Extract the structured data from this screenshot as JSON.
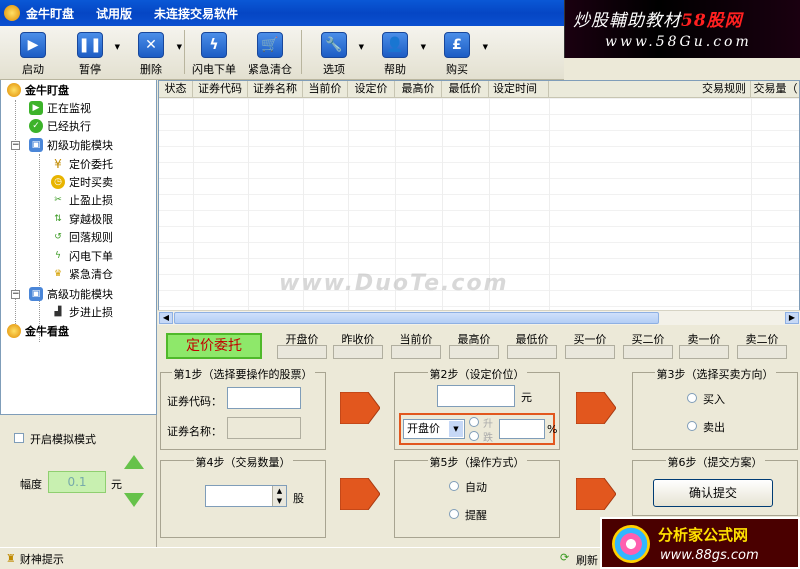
{
  "titlebar": {
    "app_name": "金牛盯盘",
    "edition": "试用版",
    "status": "未连接交易软件"
  },
  "banner": {
    "line1_prefix": "炒股輔助教材",
    "line1_brand": "58股网",
    "line2": "www.58Gu.com"
  },
  "toolbar": {
    "start": "启动",
    "pause": "暂停",
    "delete": "删除",
    "flash_order": "闪电下单",
    "emergency_clear": "紧急清仓",
    "options": "选项",
    "help": "帮助",
    "buy": "购买"
  },
  "tree": {
    "root1": "金牛盯盘",
    "monitoring": "正在监视",
    "executed": "已经执行",
    "basic_group": "初级功能模块",
    "basic_items": [
      "定价委托",
      "定时买卖",
      "止盈止损",
      "穿越极限",
      "回落规则",
      "闪电下单",
      "紧急清仓"
    ],
    "advanced_group": "高级功能模块",
    "advanced_items": [
      "步进止损"
    ],
    "root2": "金牛看盘"
  },
  "left_bottom": {
    "sim_mode_label": "开启模拟模式",
    "range_label": "幅度",
    "range_value": "0.1",
    "unit": "元"
  },
  "grid": {
    "columns": [
      "状态",
      "证券代码",
      "证券名称",
      "当前价",
      "设定价",
      "最高价",
      "最低价",
      "设定时间",
      "交易规则",
      "交易量（"
    ],
    "watermark": "www.DuoTe.com"
  },
  "order_bar": {
    "mode_button": "定价委托",
    "quotes": [
      "开盘价",
      "昨收价",
      "当前价",
      "最高价",
      "最低价",
      "买一价",
      "买二价",
      "卖一价",
      "卖二价"
    ]
  },
  "step1": {
    "title": "第1步（选择要操作的股票）",
    "code_label": "证券代码：",
    "name_label": "证券名称："
  },
  "step2": {
    "title": "第2步（设定价位）",
    "yuan": "元",
    "price_base": "开盘价",
    "opt_up": "升",
    "opt_down": "跌",
    "percent": "%"
  },
  "step3": {
    "title": "第3步（选择买卖方向）",
    "buy": "买入",
    "sell": "卖出"
  },
  "step4": {
    "title": "第4步（交易数量）",
    "unit": "股"
  },
  "step5": {
    "title": "第5步（操作方式）",
    "auto": "自动",
    "remind": "提醒"
  },
  "step6": {
    "title": "第6步（提交方案）",
    "submit": "确认提交"
  },
  "statusbar": {
    "tips": "财神提示",
    "refresh": "刷新"
  },
  "ad": {
    "name": "分析家公式网",
    "url": "www.88gs.com"
  }
}
